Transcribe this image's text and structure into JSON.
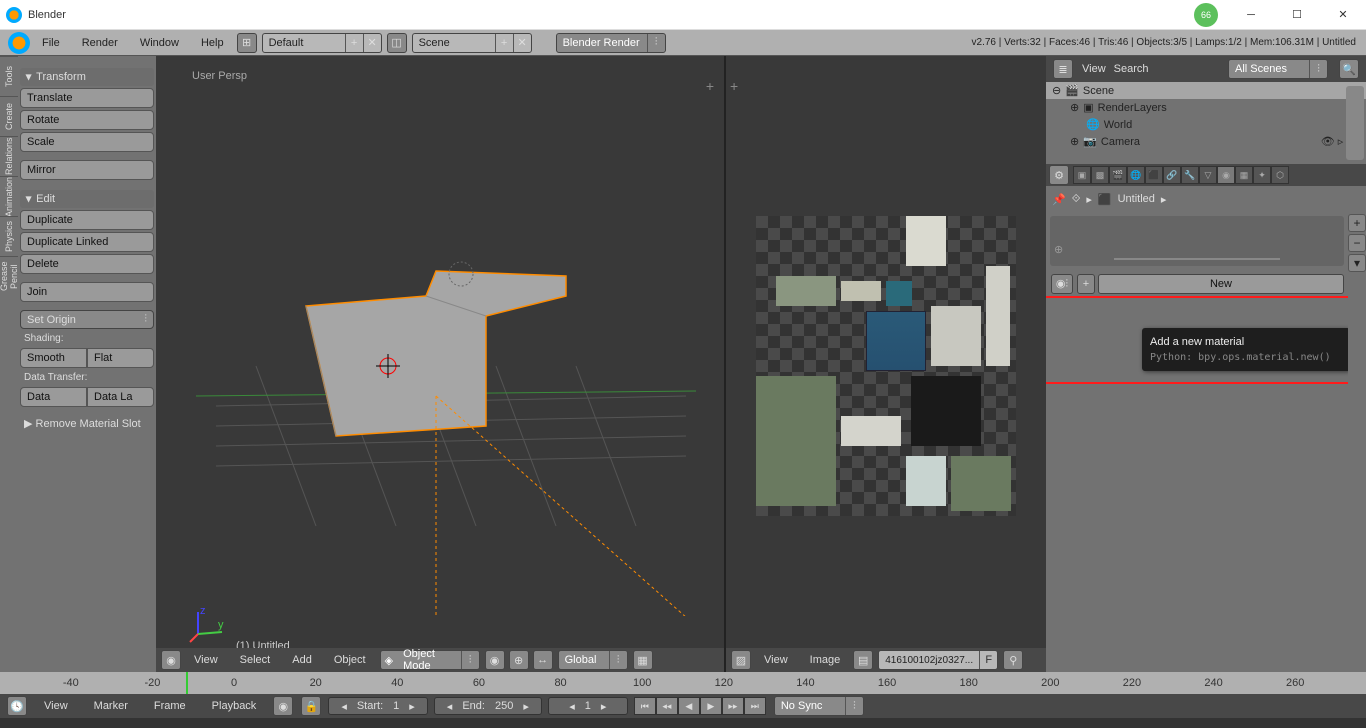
{
  "title": "Blender",
  "win_badge": "66",
  "menu": {
    "file": "File",
    "render": "Render",
    "window": "Window",
    "help": "Help",
    "default": "Default",
    "scene": "Scene",
    "engine": "Blender Render"
  },
  "stats": "v2.76 | Verts:32 | Faces:46 | Tris:46 | Objects:3/5 | Lamps:1/2 | Mem:106.31M | Untitled",
  "side_tabs": [
    "Tools",
    "Create",
    "Relations",
    "Animation",
    "Physics",
    "Grease Pencil"
  ],
  "tools": {
    "transform": "Transform",
    "translate": "Translate",
    "rotate": "Rotate",
    "scale": "Scale",
    "mirror": "Mirror",
    "edit": "Edit",
    "duplicate": "Duplicate",
    "dup_linked": "Duplicate Linked",
    "delete": "Delete",
    "join": "Join",
    "set_origin": "Set Origin",
    "shading": "Shading:",
    "smooth": "Smooth",
    "flat": "Flat",
    "data_transfer": "Data Transfer:",
    "data": "Data",
    "data_la": "Data La"
  },
  "operator_panel": "Remove Material Slot",
  "viewport": {
    "persp": "User Persp",
    "obj": "(1) Untitled"
  },
  "vp_header": {
    "view": "View",
    "select": "Select",
    "add": "Add",
    "object": "Object",
    "mode": "Object Mode",
    "global": "Global"
  },
  "img_header": {
    "view": "View",
    "image": "Image",
    "file": "416100102jz0327..."
  },
  "outliner": {
    "view": "View",
    "search": "Search",
    "all": "All Scenes",
    "scene": "Scene",
    "render_layers": "RenderLayers",
    "world": "World",
    "camera": "Camera"
  },
  "props": {
    "untitled": "Untitled",
    "new": "New",
    "tooltip_title": "Add a new material",
    "tooltip_sub": "Python: bpy.ops.material.new()"
  },
  "timeline": {
    "ticks": [
      "-40",
      "-20",
      "0",
      "20",
      "40",
      "60",
      "80",
      "100",
      "120",
      "140",
      "160",
      "180",
      "200",
      "220",
      "240",
      "260"
    ]
  },
  "tl": {
    "view": "View",
    "marker": "Marker",
    "frame": "Frame",
    "playback": "Playback",
    "start": "Start:",
    "start_v": "1",
    "end": "End:",
    "end_v": "250",
    "cur": "1",
    "nosync": "No Sync"
  }
}
